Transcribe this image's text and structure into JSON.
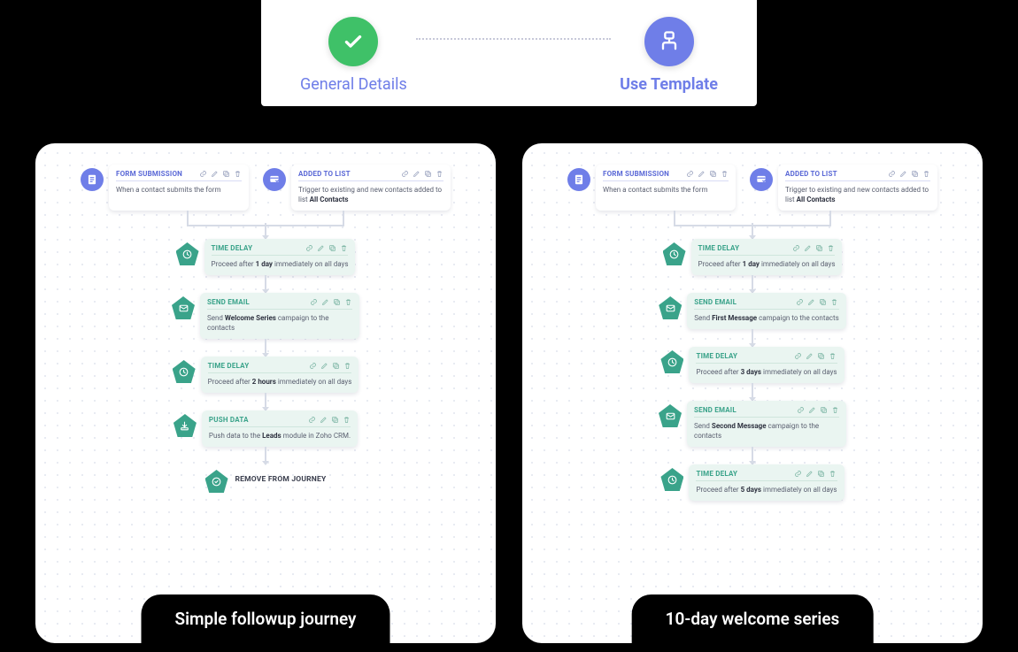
{
  "stepper": {
    "step1": {
      "label": "General Details",
      "state": "done"
    },
    "step2": {
      "label": "Use Template",
      "state": "active"
    }
  },
  "templates": [
    {
      "title": "Simple followup  journey",
      "triggers": [
        {
          "type": "form",
          "title": "FORM SUBMISSION",
          "body_pre": "When a contact submits the form",
          "body_bold": "",
          "body_post": ""
        },
        {
          "type": "list",
          "title": "ADDED TO LIST",
          "body_pre": "Trigger to existing and new contacts added to list ",
          "body_bold": "All Contacts",
          "body_post": ""
        }
      ],
      "steps": [
        {
          "type": "delay",
          "title": "TIME DELAY",
          "body_pre": "Proceed after ",
          "body_bold": "1 day",
          "body_post": " immediately on all days"
        },
        {
          "type": "email",
          "title": "SEND EMAIL",
          "body_pre": "Send ",
          "body_bold": "Welcome Series",
          "body_post": " campaign to the contacts"
        },
        {
          "type": "delay",
          "title": "TIME DELAY",
          "body_pre": "Proceed after ",
          "body_bold": "2 hours",
          "body_post": " immediately on all days"
        },
        {
          "type": "push",
          "title": "PUSH DATA",
          "body_pre": "Push data to the ",
          "body_bold": "Leads",
          "body_post": " module in Zoho CRM."
        }
      ],
      "end": {
        "title": "REMOVE FROM JOURNEY"
      }
    },
    {
      "title": "10-day welcome series",
      "triggers": [
        {
          "type": "form",
          "title": "FORM SUBMISSION",
          "body_pre": "When a contact submits the form",
          "body_bold": "",
          "body_post": ""
        },
        {
          "type": "list",
          "title": "ADDED TO LIST",
          "body_pre": "Trigger to existing and new contacts added to list ",
          "body_bold": "All Contacts",
          "body_post": ""
        }
      ],
      "steps": [
        {
          "type": "delay",
          "title": "TIME DELAY",
          "body_pre": "Proceed after ",
          "body_bold": "1 day",
          "body_post": " immediately on all days"
        },
        {
          "type": "email",
          "title": "SEND EMAIL",
          "body_pre": "Send ",
          "body_bold": "First Message",
          "body_post": " campaign to the contacts"
        },
        {
          "type": "delay",
          "title": "TIME DELAY",
          "body_pre": "Proceed after ",
          "body_bold": "3 days",
          "body_post": " immediately on all days"
        },
        {
          "type": "email",
          "title": "SEND EMAIL",
          "body_pre": "Send ",
          "body_bold": "Second Message",
          "body_post": " campaign to the contacts"
        },
        {
          "type": "delay",
          "title": "TIME DELAY",
          "body_pre": "Proceed after ",
          "body_bold": "5 days",
          "body_post": " immediately on all days"
        }
      ],
      "end": null
    }
  ],
  "icons": {
    "actions": [
      "link",
      "edit",
      "copy",
      "delete"
    ]
  }
}
